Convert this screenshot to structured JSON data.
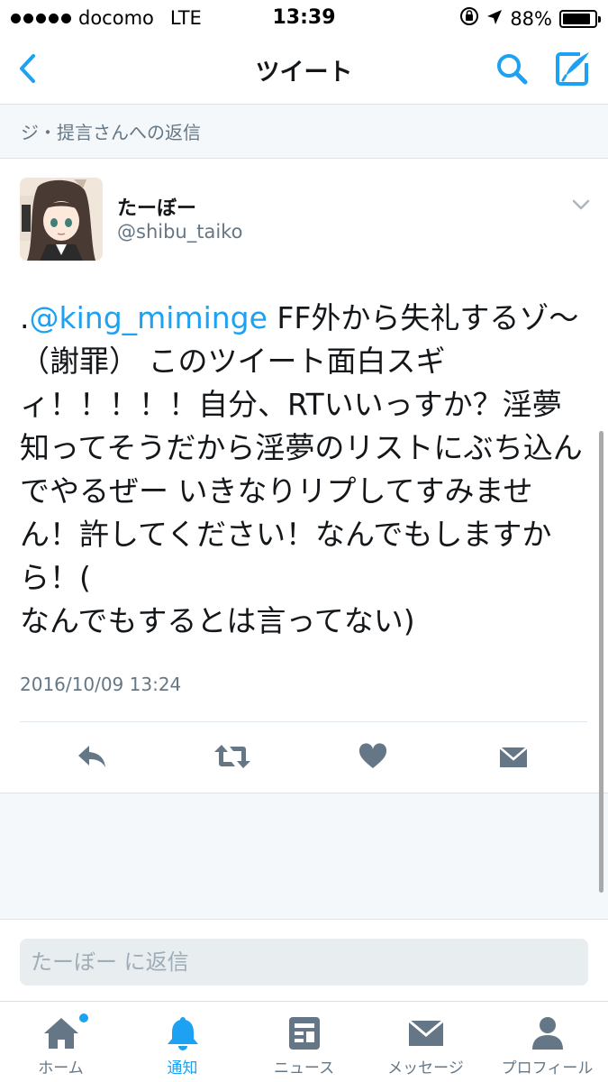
{
  "status_bar": {
    "carrier": "docomo",
    "network": "LTE",
    "time": "13:39",
    "battery_percent": "88%",
    "battery_level": 0.88
  },
  "nav": {
    "title": "ツイート"
  },
  "reply_context": "ジ・提言さんへの返信",
  "tweet": {
    "display_name": "たーぼー",
    "handle": "@shibu_taiko",
    "text_prefix": ".",
    "mention": "@king_miminge",
    "text_body": " FF外から失礼するゾ〜（謝罪） このツイート面白スギィ！！！！！自分、RTいいっすか？淫夢知ってそうだから淫夢のリストにぶち込んでやるぜー いきなりリプしてすみません！許してください！なんでもしますから！(\nなんでもするとは言ってない)",
    "timestamp": "2016/10/09 13:24"
  },
  "reply_box": {
    "placeholder": "たーぼー に返信"
  },
  "tab_bar": {
    "tabs": [
      {
        "label": "ホーム",
        "icon": "home-icon"
      },
      {
        "label": "通知",
        "icon": "bell-icon"
      },
      {
        "label": "ニュース",
        "icon": "news-icon"
      },
      {
        "label": "メッセージ",
        "icon": "envelope-icon"
      },
      {
        "label": "プロフィール",
        "icon": "person-icon"
      }
    ],
    "active_index": 1
  },
  "colors": {
    "accent": "#1da1f2",
    "icon_gray": "#657786",
    "text": "#14171a",
    "background_gray": "#f5f8fa"
  }
}
